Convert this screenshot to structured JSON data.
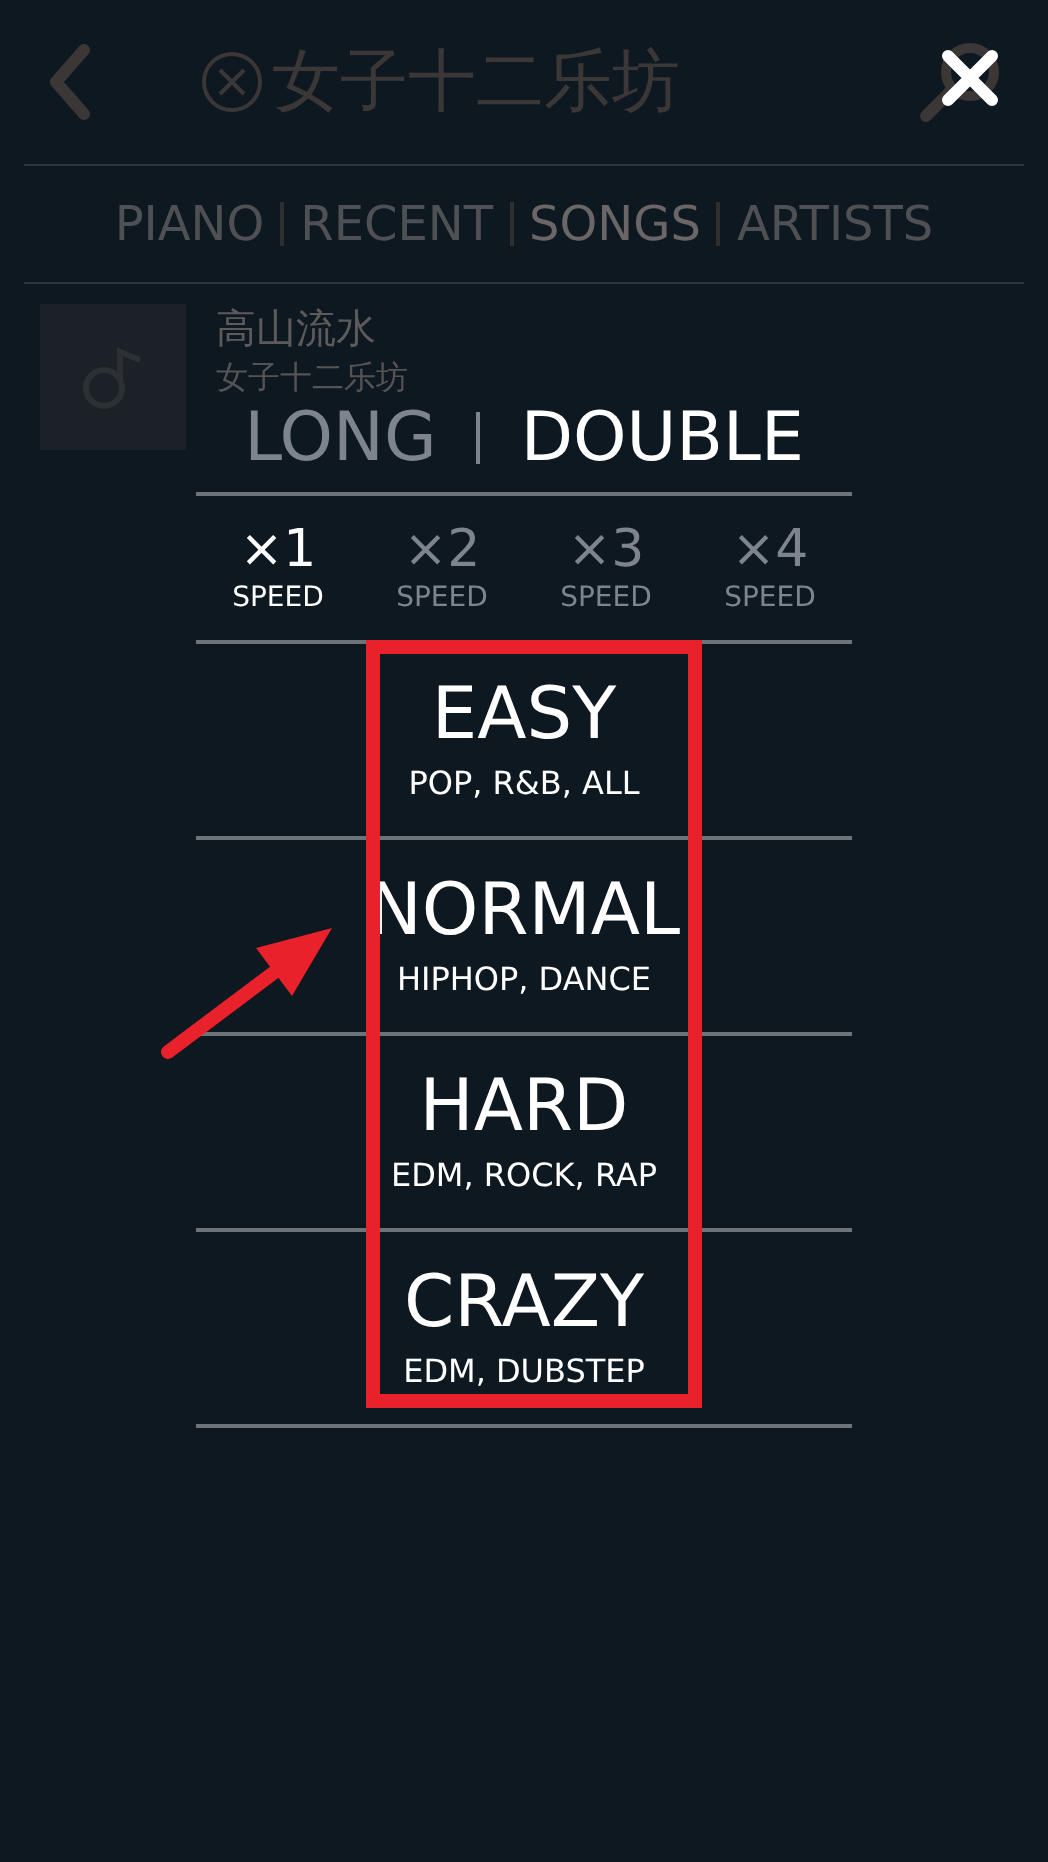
{
  "background_page": {
    "title": "女子十二乐坊",
    "tabs": [
      {
        "label": "PIANO",
        "selected": false
      },
      {
        "label": "RECENT",
        "selected": false
      },
      {
        "label": "SONGS",
        "selected": true
      },
      {
        "label": "ARTISTS",
        "selected": false
      }
    ],
    "songs": [
      {
        "title": "高山流水",
        "artist": "女子十二乐坊"
      }
    ]
  },
  "dialog": {
    "modes": [
      {
        "label": "LONG",
        "selected": false
      },
      {
        "label": "DOUBLE",
        "selected": true
      }
    ],
    "speeds": [
      {
        "multiplier": "×1",
        "label": "SPEED",
        "selected": true
      },
      {
        "multiplier": "×2",
        "label": "SPEED",
        "selected": false
      },
      {
        "multiplier": "×3",
        "label": "SPEED",
        "selected": false
      },
      {
        "multiplier": "×4",
        "label": "SPEED",
        "selected": false
      }
    ],
    "difficulties": [
      {
        "name": "EASY",
        "genres": "POP, R&B, ALL"
      },
      {
        "name": "NORMAL",
        "genres": "HIPHOP, DANCE"
      },
      {
        "name": "HARD",
        "genres": "EDM, ROCK, RAP"
      },
      {
        "name": "CRAZY",
        "genres": "EDM, DUBSTEP"
      }
    ]
  }
}
